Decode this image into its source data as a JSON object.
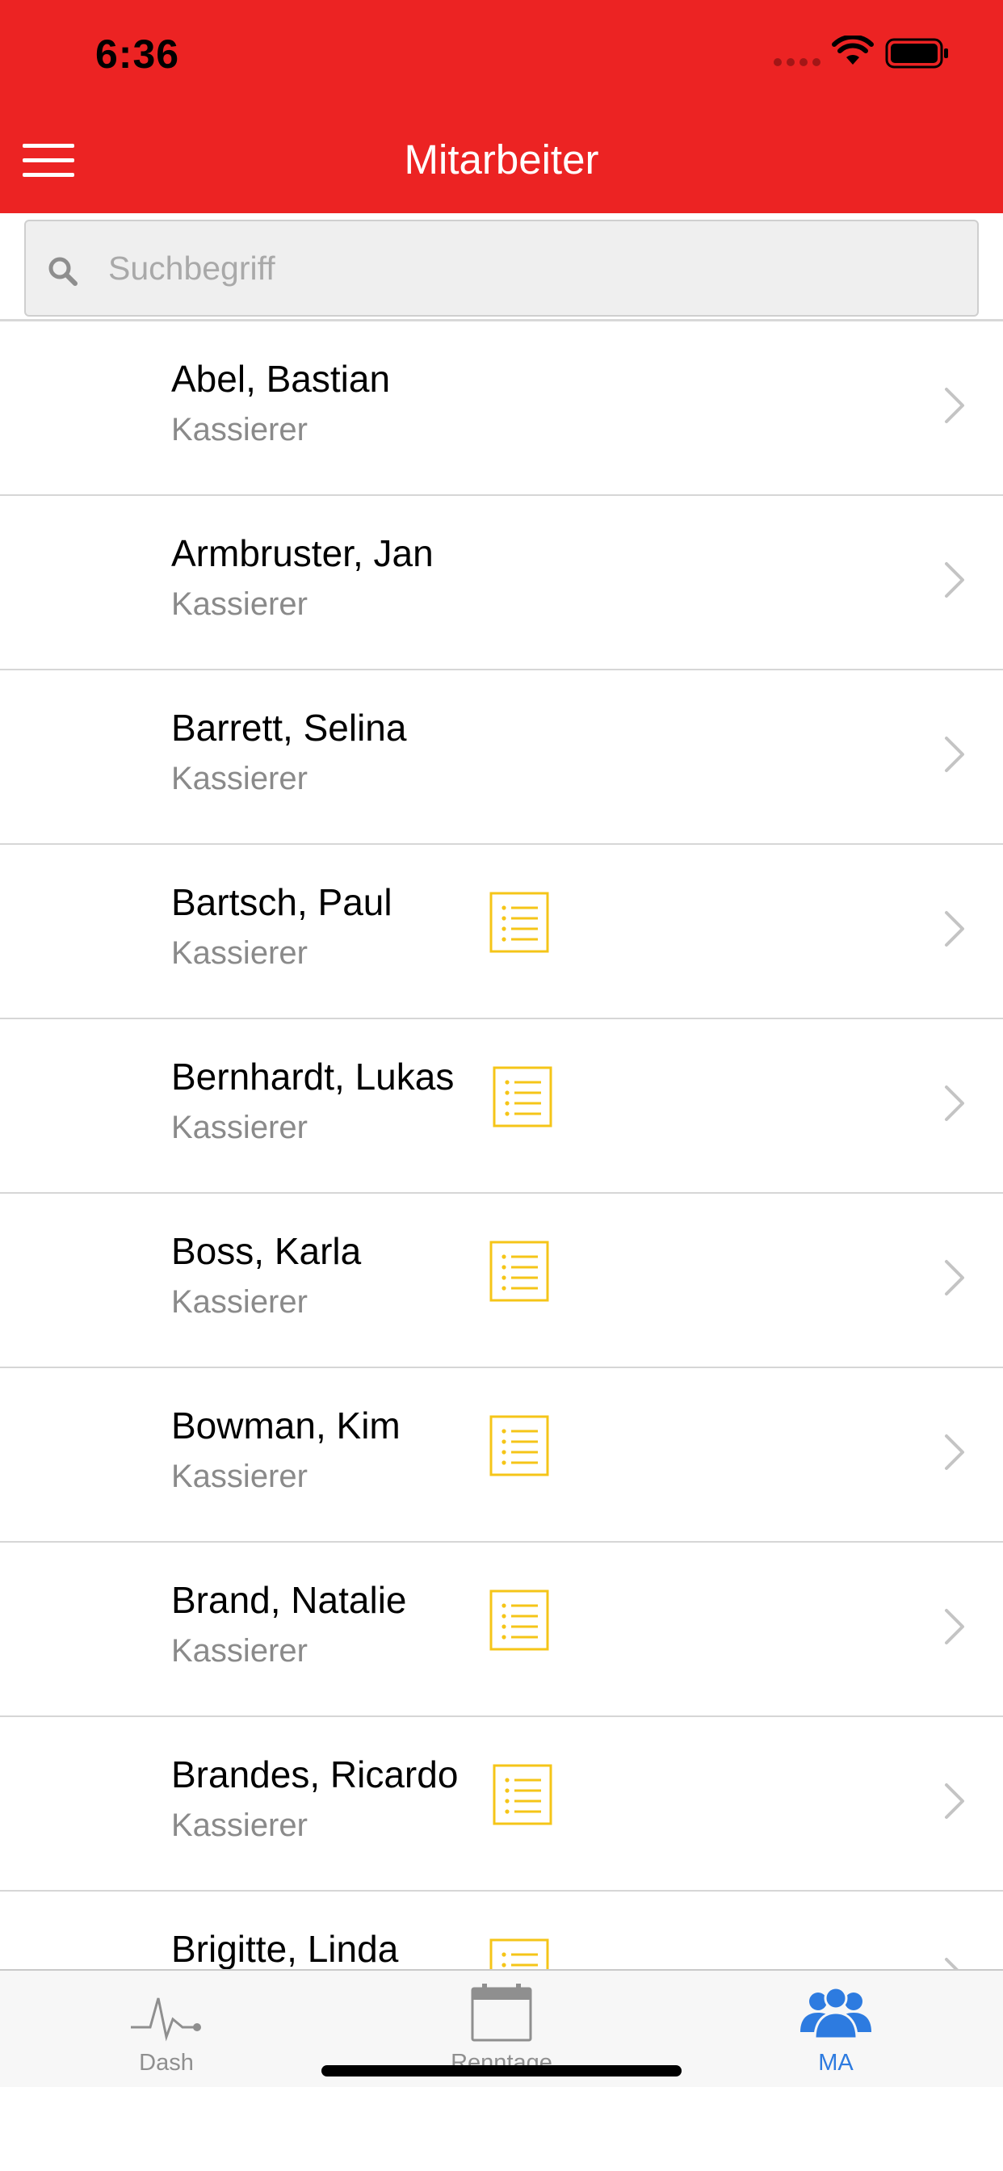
{
  "status_bar": {
    "time": "6:36"
  },
  "header": {
    "title": "Mitarbeiter"
  },
  "search": {
    "placeholder": "Suchbegriff"
  },
  "employees": [
    {
      "name": "Abel, Bastian",
      "role": "Kassierer",
      "has_list": false
    },
    {
      "name": "Armbruster, Jan",
      "role": "Kassierer",
      "has_list": false
    },
    {
      "name": "Barrett, Selina",
      "role": "Kassierer",
      "has_list": false
    },
    {
      "name": "Bartsch, Paul",
      "role": "Kassierer",
      "has_list": true
    },
    {
      "name": "Bernhardt, Lukas",
      "role": "Kassierer",
      "has_list": true
    },
    {
      "name": "Boss, Karla",
      "role": "Kassierer",
      "has_list": true
    },
    {
      "name": "Bowman, Kim",
      "role": "Kassierer",
      "has_list": true
    },
    {
      "name": "Brand, Natalie",
      "role": "Kassierer",
      "has_list": true
    },
    {
      "name": "Brandes, Ricardo",
      "role": "Kassierer",
      "has_list": true
    },
    {
      "name": "Brigitte, Linda",
      "role": "",
      "has_list": true
    }
  ],
  "tabbar": {
    "tabs": [
      {
        "label": "Dash",
        "icon": "activity-icon",
        "active": false
      },
      {
        "label": "Renntage",
        "icon": "calendar-icon",
        "active": false
      },
      {
        "label": "MA",
        "icon": "people-icon",
        "active": true
      }
    ]
  },
  "colors": {
    "header": "#EC2323",
    "accent": "#2D7BE0",
    "list_icon": "#F5C518"
  }
}
